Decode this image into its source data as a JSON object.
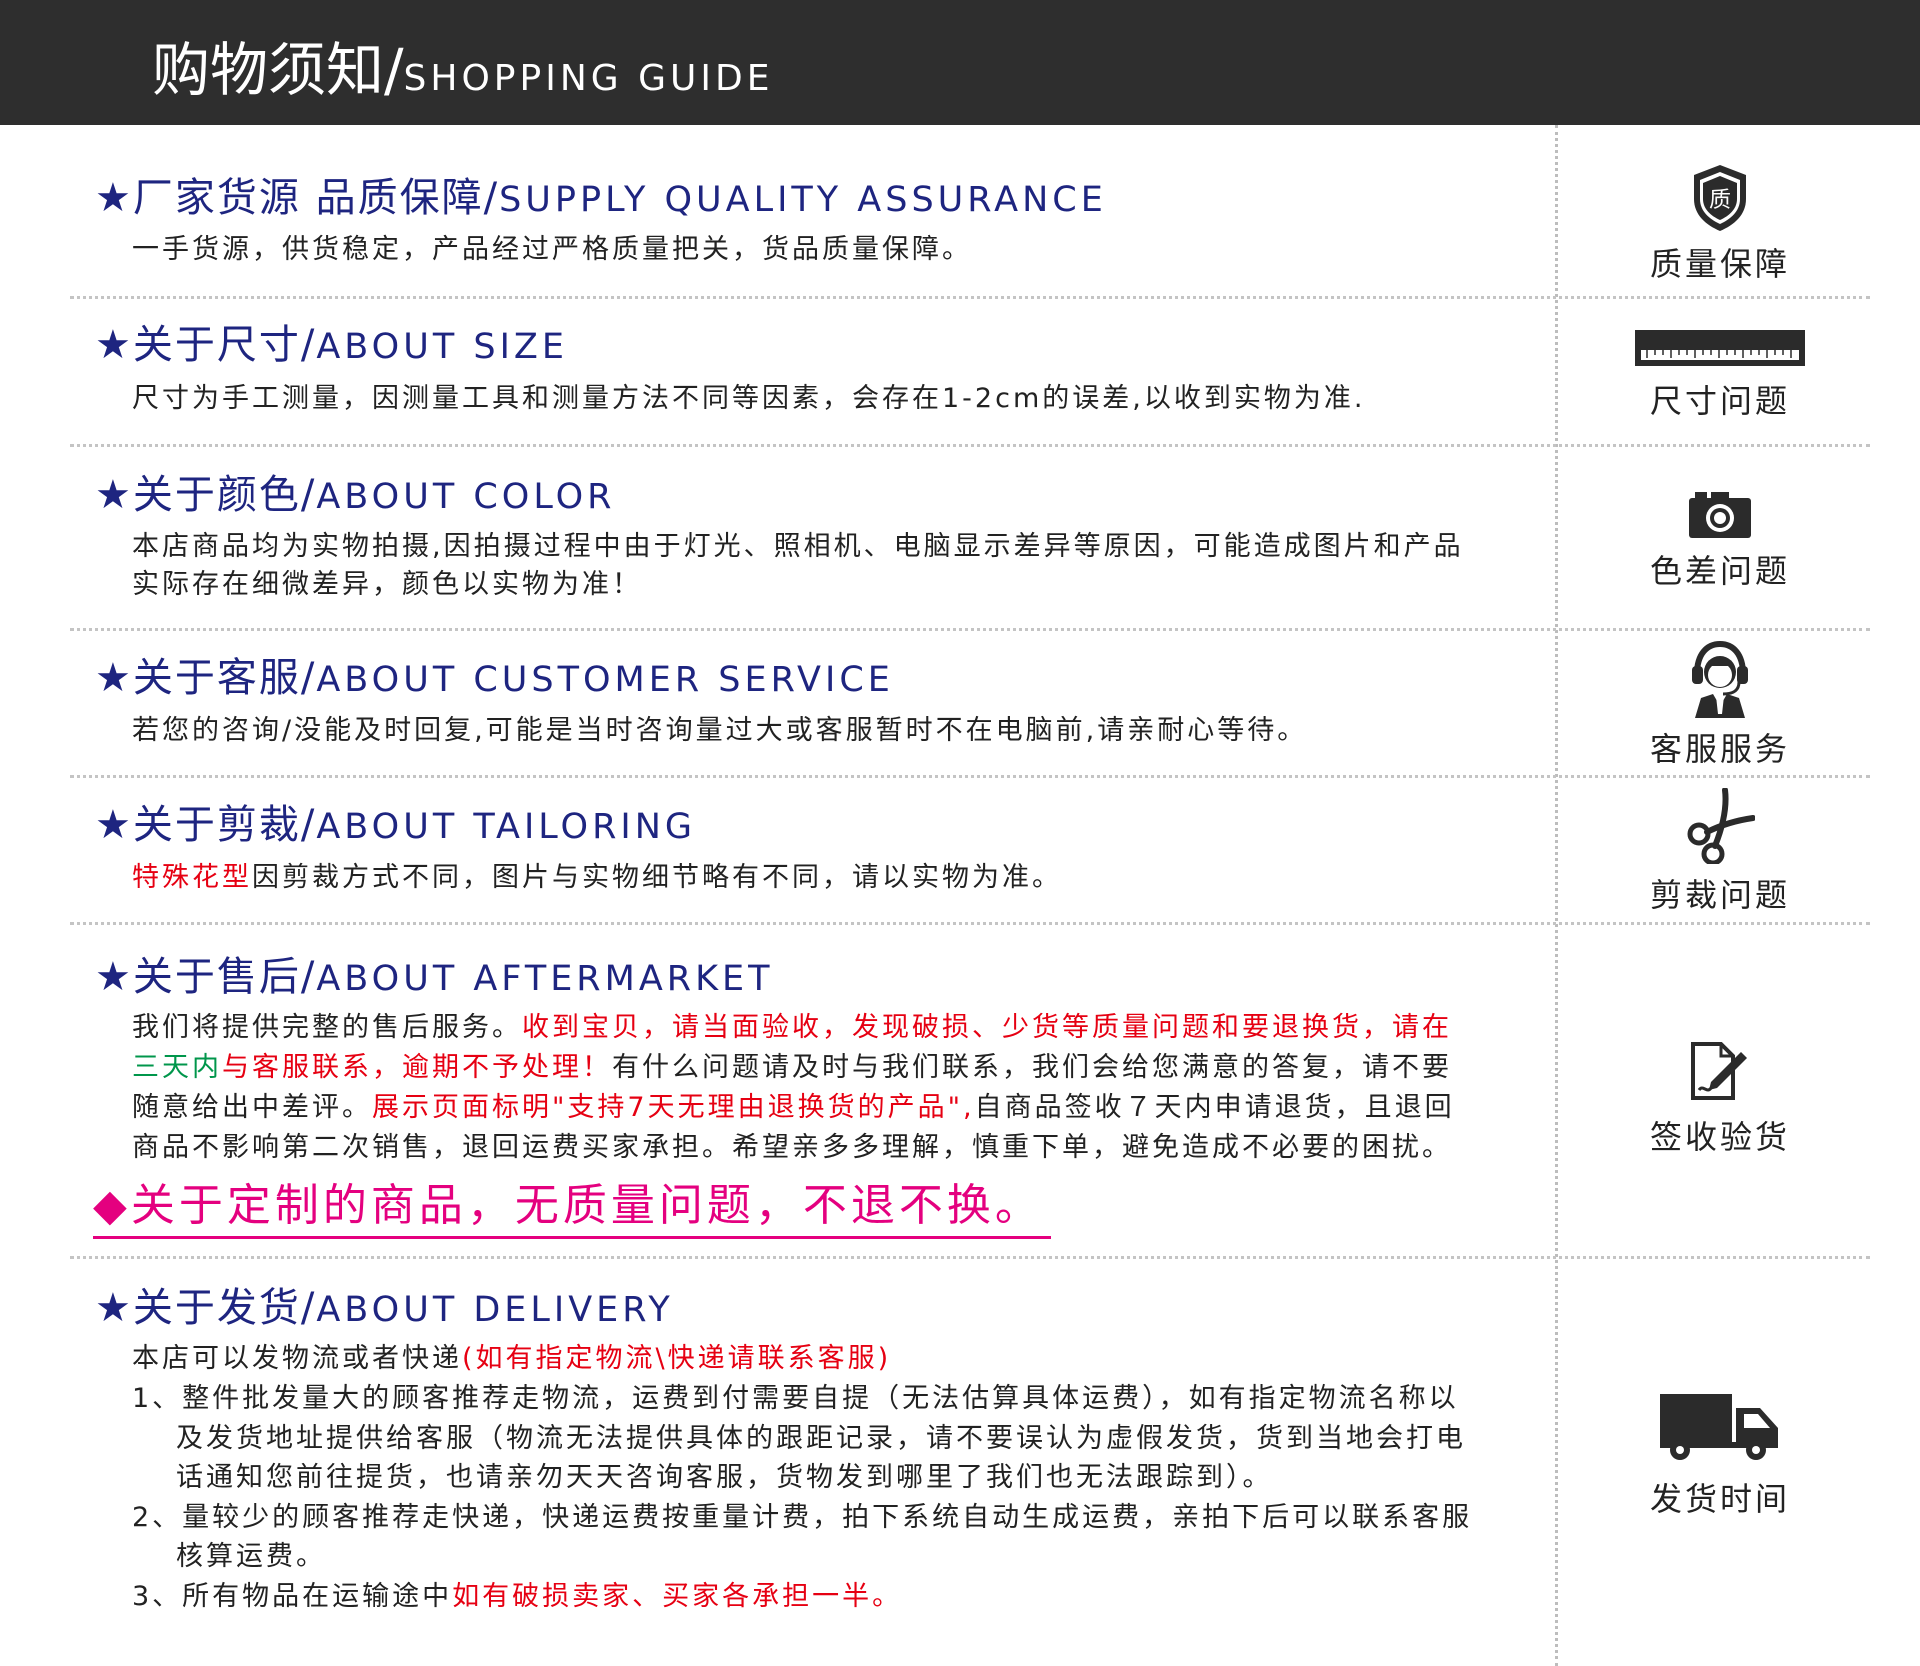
{
  "header": {
    "title_cn": "购物须知/",
    "title_en": "SHOPPING GUIDE"
  },
  "sections": [
    {
      "star": "★",
      "title_cn": "厂家货源 品质保障/",
      "title_en": "SUPPLY QUALITY ASSURANCE",
      "text": "一手货源，供货稳定，产品经过严格质量把关，货品质量保障。",
      "icon": "shield-icon",
      "icon_char": "质",
      "label": "质量保障"
    },
    {
      "star": "★",
      "title_cn": "关于尺寸/",
      "title_en": "ABOUT SIZE",
      "text": "尺寸为手工测量，因测量工具和测量方法不同等因素，会存在1-2cm的误差,以收到实物为准.",
      "icon": "ruler-icon",
      "label": "尺寸问题"
    },
    {
      "star": "★",
      "title_cn": "关于颜色/",
      "title_en": "ABOUT COLOR",
      "text_line1": "本店商品均为实物拍摄,因拍摄过程中由于灯光、照相机、电脑显示差异等原因，可能造成图片和产品",
      "text_line2": "实际存在细微差异，颜色以实物为准！",
      "icon": "camera-icon",
      "label": "色差问题"
    },
    {
      "star": "★",
      "title_cn": "关于客服/",
      "title_en": "ABOUT CUSTOMER SERVICE",
      "text": "若您的咨询/没能及时回复,可能是当时咨询量过大或客服暂时不在电脑前,请亲耐心等待。",
      "icon": "headset-agent-icon",
      "label": "客服服务"
    },
    {
      "star": "★",
      "title_cn": "关于剪裁/",
      "title_en": "ABOUT TAILORING",
      "text_red": "特殊花型",
      "text": "因剪裁方式不同，图片与实物细节略有不同，请以实物为准。",
      "icon": "scissors-icon",
      "label": "剪裁问题"
    },
    {
      "star": "★",
      "title_cn": "关于售后/",
      "title_en": "ABOUT AFTERMARKET",
      "l1_a": "我们将提供完整的售后服务。",
      "l1_b": "收到宝贝，请当面验收，发现破损、少货等质量问题和要退换货，请在",
      "l2_a": "三天内",
      "l2_b": "与客服联系，逾期不予处理！",
      "l2_c": "有什么问题请及时与我们联系，我们会给您满意的答复，请不要",
      "l3_a": "随意给出中差评。",
      "l3_b": "展示页面标明\"支持7天无理由退换货的产品\",",
      "l3_c": "自商品签收７天内申请退货，且退回",
      "l4": "商品不影响第二次销售，退回运费买家承担。希望亲多多理解，慎重下单，避免造成不必要的困扰。",
      "custom": "◆关于定制的商品，无质量问题，不退不换。",
      "icon": "sign-receipt-icon",
      "label": "签收验货"
    },
    {
      "star": "★",
      "title_cn": "关于发货/",
      "title_en": "ABOUT DELIVERY",
      "l1_a": "本店可以发物流或者快递",
      "l1_b": "(如有指定物流\\快递请联系客服)",
      "l2": "1、整件批发量大的顾客推荐走物流，运费到付需要自提（无法估算具体运费），如有指定物流名称以",
      "l3": "及发货地址提供给客服（物流无法提供具体的跟距记录，请不要误认为虚假发货，货到当地会打电",
      "l4": "话通知您前往提货，也请亲勿天天咨询客服，货物发到哪里了我们也无法跟踪到）。",
      "l5": "2、量较少的顾客推荐走快递，快递运费按重量计费，拍下系统自动生成运费，亲拍下后可以联系客服",
      "l6": "核算运费。",
      "l7_a": "3、所有物品在运输途中",
      "l7_b": "如有破损卖家、买家各承担一半。",
      "icon": "delivery-truck-icon",
      "label": "发货时间"
    }
  ]
}
